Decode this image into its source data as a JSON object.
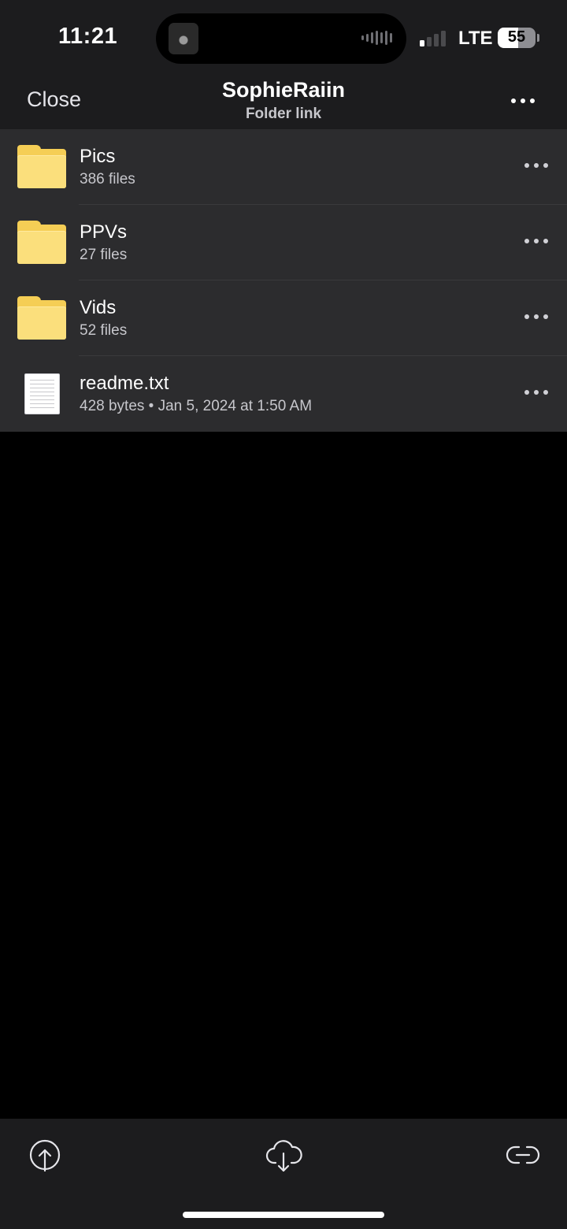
{
  "status_bar": {
    "time": "11:21",
    "network": "LTE",
    "battery_percent": "55",
    "battery_level": 0.55,
    "signal_bars_active": 1
  },
  "nav": {
    "close_label": "Close",
    "title": "SophieRaiin",
    "subtitle": "Folder link",
    "more_icon": "ellipsis-icon"
  },
  "items": [
    {
      "name": "Pics",
      "meta": "386 files",
      "icon": "folder-icon"
    },
    {
      "name": "PPVs",
      "meta": "27 files",
      "icon": "folder-icon"
    },
    {
      "name": "Vids",
      "meta": "52 files",
      "icon": "folder-icon"
    },
    {
      "name": "readme.txt",
      "meta": "428 bytes • Jan 5, 2024 at 1:50 AM",
      "icon": "text-file-icon"
    }
  ],
  "toolbar": {
    "upload_icon": "upload-icon",
    "download_icon": "cloud-download-icon",
    "link_icon": "link-icon"
  },
  "colors": {
    "background": "#000000",
    "surface": "#1c1c1e",
    "row": "#2c2c2e",
    "folder": "#f5ce55"
  }
}
